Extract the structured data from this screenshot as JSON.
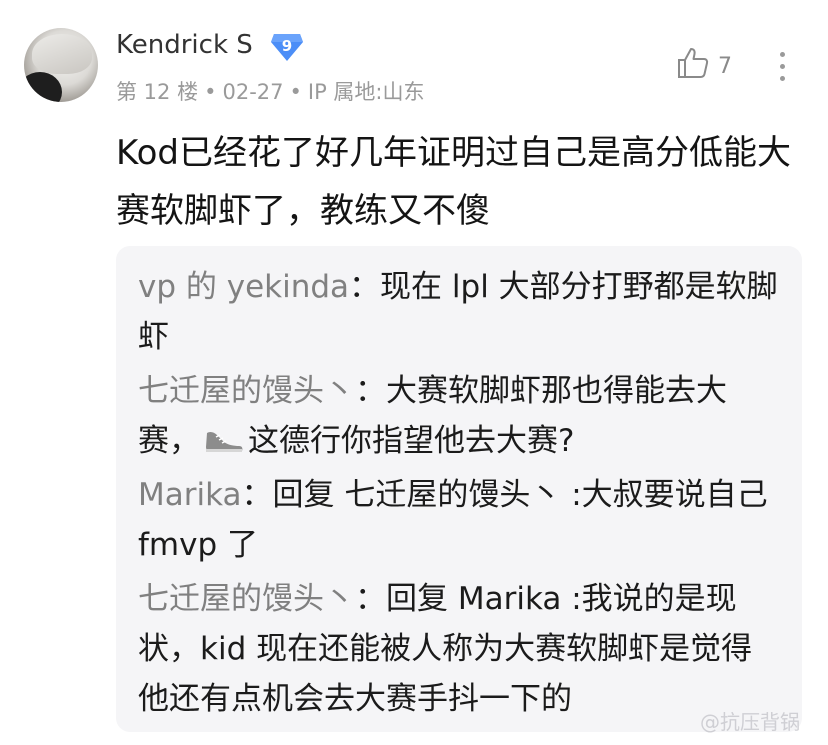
{
  "post": {
    "username": "Kendrick S",
    "level_badge": "9",
    "floor": "第 12 楼",
    "date": "02-27",
    "ip_location": "IP 属地:山东",
    "like_count": "7",
    "content": "Kod已经花了好几年证明过自己是高分低能大赛软脚虾了，教练又不傻"
  },
  "replies": [
    {
      "name": "vp 的 yekinda",
      "sep": "：",
      "text": "现在 lpl 大部分打野都是软脚虾"
    },
    {
      "name": "七迁屋的馒头丶",
      "sep": "：",
      "text_before": "大赛软脚虾那也得能去大赛，",
      "text_after": "这德行你指望他去大赛?"
    },
    {
      "name": "Marika",
      "sep": "：",
      "text": "回复 七迁屋的馒头丶 :大叔要说自己 fmvp 了"
    },
    {
      "name": "七迁屋的馒头丶",
      "sep": "：",
      "text": "回复 Marika :我说的是现状，kid 现在还能被人称为大赛软脚虾是觉得他还有点机会去大赛手抖一下的"
    }
  ],
  "watermark": "@抗压背锅",
  "colors": {
    "badge": "#4c8ef7",
    "name": "#808080",
    "quote_bg": "#f5f5f7"
  },
  "icons": [
    "thumbs-up-icon",
    "more-vertical-icon",
    "shoe-emoji-icon",
    "level-badge-icon"
  ]
}
